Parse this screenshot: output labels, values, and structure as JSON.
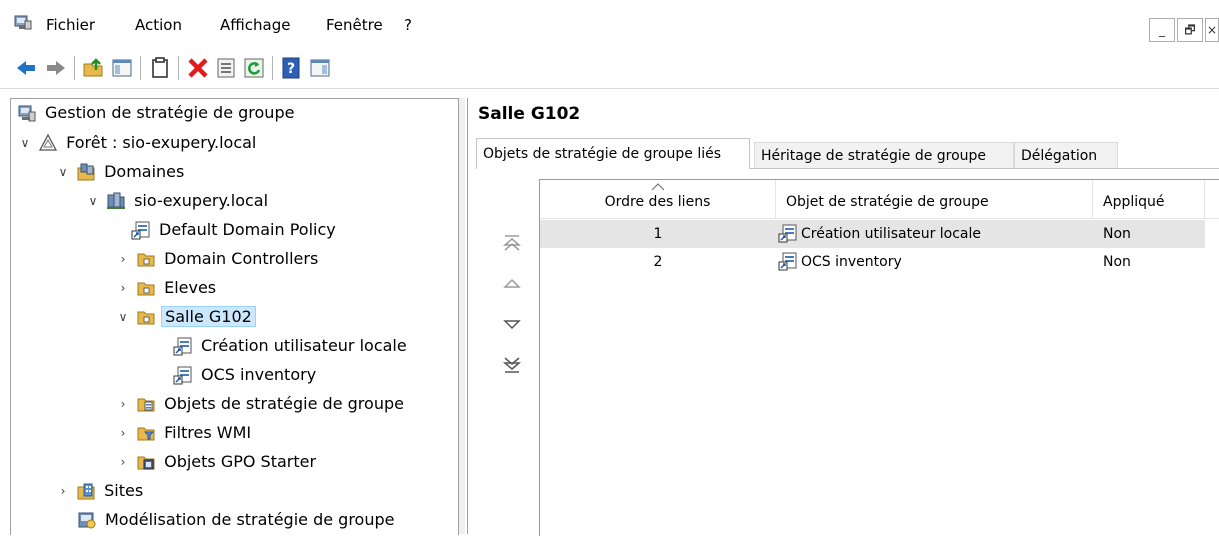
{
  "menu": {
    "items": [
      "Fichier",
      "Action",
      "Affichage",
      "Fenêtre",
      "?"
    ],
    "window_buttons": [
      "_",
      "🗗",
      "×"
    ]
  },
  "toolbar": {
    "buttons": [
      "back-arrow-icon",
      "forward-arrow-icon",
      "up-folder-icon",
      "show-hide-console-tree-icon",
      "copy-icon",
      "delete-icon",
      "properties-icon",
      "refresh-icon",
      "help-icon",
      "show-hide-action-pane-icon"
    ]
  },
  "tree": {
    "root": "Gestion de stratégie de groupe",
    "forest": "Forêt : sio-exupery.local",
    "domains": "Domaines",
    "domain": "sio-exupery.local",
    "default_policy": "Default Domain Policy",
    "domain_controllers": "Domain Controllers",
    "eleves": "Eleves",
    "salle": "Salle G102",
    "gpo1": "Création utilisateur locale",
    "gpo2": "OCS inventory",
    "gpo_container": "Objets de stratégie de groupe",
    "wmi": "Filtres WMI",
    "starter": "Objets GPO Starter",
    "sites": "Sites",
    "modeling": "Modélisation de stratégie de groupe"
  },
  "panel": {
    "title": "Salle G102",
    "tabs": [
      "Objets de stratégie de groupe liés",
      "Héritage de stratégie de groupe",
      "Délégation"
    ],
    "active_tab": 0
  },
  "grid": {
    "columns": [
      "Ordre des liens",
      "Objet de stratégie de groupe",
      "Appliqué"
    ],
    "rows": [
      {
        "order": "1",
        "gpo": "Création utilisateur locale",
        "applied": "Non"
      },
      {
        "order": "2",
        "gpo": "OCS inventory",
        "applied": "Non"
      }
    ],
    "highlighted_row": 0
  },
  "colors": {
    "selection": "#cce8ff",
    "row_highlight": "#e5e5e5",
    "border": "#a0a0a0"
  }
}
